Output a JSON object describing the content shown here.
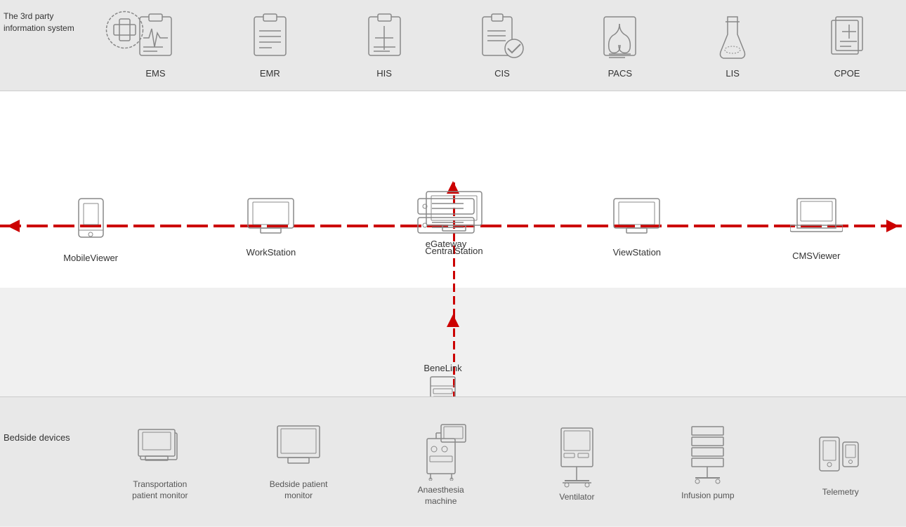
{
  "third_party_label": "The 3rd party\ninformation system",
  "top_systems": [
    {
      "id": "ems",
      "label": "EMS"
    },
    {
      "id": "emr",
      "label": "EMR"
    },
    {
      "id": "his",
      "label": "HIS"
    },
    {
      "id": "cis",
      "label": "CIS"
    },
    {
      "id": "pacs",
      "label": "PACS"
    },
    {
      "id": "lis",
      "label": "LIS"
    },
    {
      "id": "cpoe",
      "label": "CPOE"
    }
  ],
  "network_nodes": [
    {
      "id": "mobile-viewer",
      "label": "MobileViewer"
    },
    {
      "id": "workstation",
      "label": "WorkStation"
    },
    {
      "id": "central-station",
      "label": "CentralStation"
    },
    {
      "id": "view-station",
      "label": "ViewStation"
    },
    {
      "id": "cms-viewer",
      "label": "CMSViewer"
    }
  ],
  "gateway": {
    "label": "eGateway"
  },
  "benelink": {
    "label": "BeneLink"
  },
  "bedside_label": "Bedside devices",
  "bedside_devices": [
    {
      "id": "transport-monitor",
      "label": "Transportation\npatient monitor"
    },
    {
      "id": "bedside-monitor",
      "label": "Bedside patient\nmonitor"
    },
    {
      "id": "anaesthesia-machine",
      "label": "Anaesthesia\nmachine"
    },
    {
      "id": "ventilator",
      "label": "Ventilator"
    },
    {
      "id": "infusion-pump",
      "label": "Infusion pump"
    },
    {
      "id": "telemetry",
      "label": "Telemetry"
    }
  ]
}
